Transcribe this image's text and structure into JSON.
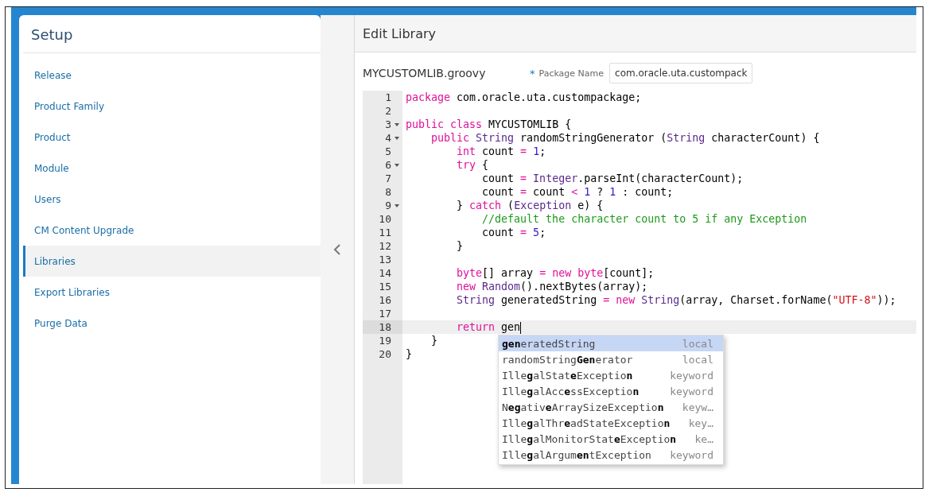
{
  "sidebar": {
    "title": "Setup",
    "items": [
      {
        "label": "Release",
        "selected": false
      },
      {
        "label": "Product Family",
        "selected": false
      },
      {
        "label": "Product",
        "selected": false
      },
      {
        "label": "Module",
        "selected": false
      },
      {
        "label": "Users",
        "selected": false
      },
      {
        "label": "CM Content Upgrade",
        "selected": false
      },
      {
        "label": "Libraries",
        "selected": true
      },
      {
        "label": "Export Libraries",
        "selected": false
      },
      {
        "label": "Purge Data",
        "selected": false
      }
    ]
  },
  "editor": {
    "title": "Edit Library",
    "file_name": "MYCUSTOMLIB.groovy",
    "package_field": {
      "required_mark": "*",
      "label": "Package Name",
      "value": "com.oracle.uta.custompack"
    },
    "lines": [
      {
        "number": "1",
        "fold": false,
        "active": false,
        "tokens": [
          {
            "kind": "keyword",
            "text": "package"
          },
          {
            "kind": "plain",
            "text": " com.oracle.uta.custompackage;"
          }
        ]
      },
      {
        "number": "2",
        "fold": false,
        "active": false
      },
      {
        "number": "3",
        "fold": true,
        "active": false,
        "tokens": [
          {
            "kind": "keyword",
            "text": "public"
          },
          {
            "kind": "keyword",
            "text": " class"
          },
          {
            "kind": "plain",
            "text": " MYCUSTOMLIB {"
          }
        ]
      },
      {
        "number": "4",
        "fold": true,
        "active": false,
        "tokens": [
          {
            "kind": "keyword",
            "text": "    public"
          },
          {
            "kind": "type",
            "text": " String"
          },
          {
            "kind": "plain",
            "text": " randomStringGenerator ("
          },
          {
            "kind": "type",
            "text": "String"
          },
          {
            "kind": "plain",
            "text": " characterCount) {"
          }
        ]
      },
      {
        "number": "5",
        "fold": false,
        "active": false,
        "tokens": [
          {
            "kind": "keyword",
            "text": "        int"
          },
          {
            "kind": "plain",
            "text": " count"
          },
          {
            "kind": "keyword",
            "text": " ="
          },
          {
            "kind": "number",
            "text": " 1"
          },
          {
            "kind": "plain",
            "text": ";"
          }
        ]
      },
      {
        "number": "6",
        "fold": true,
        "active": false,
        "tokens": [
          {
            "kind": "keyword",
            "text": "        try"
          },
          {
            "kind": "plain",
            "text": " {"
          }
        ]
      },
      {
        "number": "7",
        "fold": false,
        "active": false,
        "tokens": [
          {
            "kind": "plain",
            "text": "            count"
          },
          {
            "kind": "keyword",
            "text": " ="
          },
          {
            "kind": "type",
            "text": " Integer"
          },
          {
            "kind": "plain",
            "text": ".parseInt(characterCount);"
          }
        ]
      },
      {
        "number": "8",
        "fold": false,
        "active": false,
        "tokens": [
          {
            "kind": "plain",
            "text": "            count"
          },
          {
            "kind": "keyword",
            "text": " ="
          },
          {
            "kind": "plain",
            "text": " count"
          },
          {
            "kind": "keyword",
            "text": " <"
          },
          {
            "kind": "number",
            "text": " 1"
          },
          {
            "kind": "plain",
            "text": " ?"
          },
          {
            "kind": "number",
            "text": " 1"
          },
          {
            "kind": "plain",
            "text": " : count;"
          }
        ]
      },
      {
        "number": "9",
        "fold": true,
        "active": false,
        "tokens": [
          {
            "kind": "plain",
            "text": "        }"
          },
          {
            "kind": "keyword",
            "text": " catch"
          },
          {
            "kind": "plain",
            "text": " ("
          },
          {
            "kind": "type",
            "text": "Exception"
          },
          {
            "kind": "plain",
            "text": " e) {"
          }
        ]
      },
      {
        "number": "10",
        "fold": false,
        "active": false,
        "tokens": [
          {
            "kind": "comment",
            "text": "            //default the character count to 5 if any Exception"
          }
        ]
      },
      {
        "number": "11",
        "fold": false,
        "active": false,
        "tokens": [
          {
            "kind": "plain",
            "text": "            count"
          },
          {
            "kind": "keyword",
            "text": " ="
          },
          {
            "kind": "number",
            "text": " 5"
          },
          {
            "kind": "plain",
            "text": ";"
          }
        ]
      },
      {
        "number": "12",
        "fold": false,
        "active": false,
        "tokens": [
          {
            "kind": "plain",
            "text": "        }"
          }
        ]
      },
      {
        "number": "13",
        "fold": false,
        "active": false
      },
      {
        "number": "14",
        "fold": false,
        "active": false,
        "tokens": [
          {
            "kind": "keyword",
            "text": "        byte"
          },
          {
            "kind": "plain",
            "text": "[] array"
          },
          {
            "kind": "keyword",
            "text": " ="
          },
          {
            "kind": "keyword",
            "text": " new"
          },
          {
            "kind": "keyword",
            "text": " byte"
          },
          {
            "kind": "plain",
            "text": "[count];"
          }
        ]
      },
      {
        "number": "15",
        "fold": false,
        "active": false,
        "tokens": [
          {
            "kind": "keyword",
            "text": "        new"
          },
          {
            "kind": "type",
            "text": " Random"
          },
          {
            "kind": "plain",
            "text": "().nextBytes(array);"
          }
        ]
      },
      {
        "number": "16",
        "fold": false,
        "active": false,
        "tokens": [
          {
            "kind": "type",
            "text": "        String"
          },
          {
            "kind": "plain",
            "text": " generatedString"
          },
          {
            "kind": "keyword",
            "text": " ="
          },
          {
            "kind": "keyword",
            "text": " new"
          },
          {
            "kind": "type",
            "text": " String"
          },
          {
            "kind": "plain",
            "text": "(array, Charset.forName("
          },
          {
            "kind": "string",
            "text": "\"UTF-8\""
          },
          {
            "kind": "plain",
            "text": "));"
          }
        ]
      },
      {
        "number": "17",
        "fold": false,
        "active": false
      },
      {
        "number": "18",
        "fold": false,
        "active": true,
        "tokens": [
          {
            "kind": "keyword",
            "text": "        return"
          },
          {
            "kind": "plain",
            "text": " gen"
          }
        ]
      },
      {
        "number": "19",
        "fold": false,
        "active": false,
        "tokens": [
          {
            "kind": "plain",
            "text": "    }"
          }
        ]
      },
      {
        "number": "20",
        "fold": false,
        "active": false,
        "tokens": [
          {
            "kind": "plain",
            "text": "}"
          }
        ]
      }
    ],
    "autocomplete": [
      {
        "label": "**gen**eratedString",
        "kind": "local",
        "selected": true
      },
      {
        "label": "randomString**Gen**erator",
        "kind": "local",
        "selected": false
      },
      {
        "label": "Ille**g**alStat**e**Exceptio**n**",
        "kind": "keyword",
        "selected": false
      },
      {
        "label": "Ille**g**alAcc**e**ssExceptio**n**",
        "kind": "keyword",
        "selected": false
      },
      {
        "label": "N**eg**ativ**e**ArraySizeExceptio**n**",
        "kind": "keyw…",
        "selected": false
      },
      {
        "label": "Ille**g**alThr**e**adStateExceptio**n**",
        "kind": "key…",
        "selected": false
      },
      {
        "label": "Ille**g**alMonitorStat**e**Exceptio**n**",
        "kind": "ke…",
        "selected": false
      },
      {
        "label": "Ille**g**alArgum**en**tException",
        "kind": "keyword",
        "selected": false
      }
    ]
  }
}
